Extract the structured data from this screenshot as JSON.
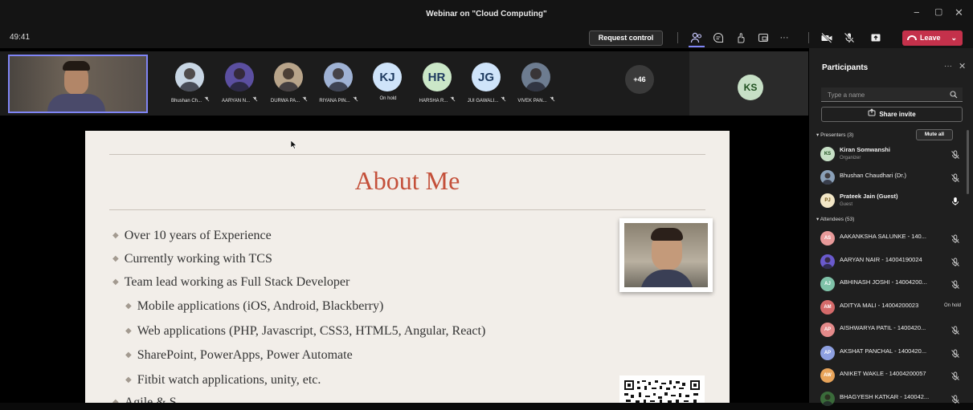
{
  "window": {
    "title": "Webinar on \"Cloud Computing\"",
    "minimize": "−",
    "maximize": "▢",
    "close": "✕"
  },
  "toolbar": {
    "timer": "49:41",
    "request_control": "Request control",
    "leave": "Leave",
    "leave_dropdown": "⌄",
    "more": "···"
  },
  "strip": {
    "participants": [
      {
        "name": "Bhushan Ch...",
        "initials": "",
        "bg": "#c8d6e4"
      },
      {
        "name": "AARYAN N...",
        "initials": "",
        "bg": "#5b4fa0"
      },
      {
        "name": "DURWA PA...",
        "initials": "",
        "bg": "#b8a48a"
      },
      {
        "name": "RIYANA PIN...",
        "initials": "",
        "bg": "#9fb2d4"
      },
      {
        "name": "On hold",
        "initials": "KJ",
        "bg": "#cfe4fa"
      },
      {
        "name": "HARSHA R...",
        "initials": "HR",
        "bg": "#cbe7c8"
      },
      {
        "name": "JUI GAWALI...",
        "initials": "JG",
        "bg": "#cfe4fa"
      },
      {
        "name": "VIVEK PAN...",
        "initials": "",
        "bg": "#6d7c90"
      }
    ],
    "overflow": "+46",
    "host_initials": "KS"
  },
  "slide": {
    "title": "About Me",
    "bullets": [
      "Over 10 years of Experience",
      "Currently working with TCS",
      "Team lead working as Full Stack Developer"
    ],
    "sub_bullets": [
      "Mobile applications (iOS, Android, Blackberry)",
      "Web applications (PHP, Javascript, CSS3, HTML5, Angular, React)",
      "SharePoint, PowerApps, Power Automate",
      "Fitbit watch applications, unity, etc."
    ],
    "partial_bullet": "Agile & S..."
  },
  "panel": {
    "title": "Participants",
    "more": "···",
    "close": "✕",
    "search_placeholder": "Type a name",
    "share_invite": "Share invite",
    "presenters_header": "Presenters (3)",
    "mute_all": "Mute all",
    "attendees_header": "Attendees (53)",
    "presenters": [
      {
        "name": "Kiran Somwanshi",
        "role": "Organizer",
        "initials": "KS",
        "bg": "#c7e0c6",
        "fg": "#1e4f1e"
      },
      {
        "name": "Bhushan Chaudhari (Dr.)",
        "role": "",
        "initials": "",
        "bg": "#8aa0b8",
        "fg": "#fff"
      },
      {
        "name": "Prateek Jain (Guest)",
        "role": "Guest",
        "initials": "PJ",
        "bg": "#f3e7c7",
        "fg": "#6b4f10"
      }
    ],
    "attendees": [
      {
        "name": "AAKANKSHA SALUNKE - 140...",
        "initials": "AS",
        "bg": "#e89a9a",
        "fg": "#fff",
        "status": ""
      },
      {
        "name": "AARYAN NAIR - 14004190024",
        "initials": "",
        "bg": "#6a5acd",
        "fg": "#fff",
        "status": ""
      },
      {
        "name": "ABHINASH JOSHI - 14004200...",
        "initials": "AJ",
        "bg": "#7fc2a8",
        "fg": "#fff",
        "status": ""
      },
      {
        "name": "ADITYA MALI - 14004200023",
        "initials": "AM",
        "bg": "#d46a6a",
        "fg": "#fff",
        "status": "On hold"
      },
      {
        "name": "AISHWARYA PATIL - 1400420...",
        "initials": "AP",
        "bg": "#e48a8a",
        "fg": "#fff",
        "status": ""
      },
      {
        "name": "AKSHAT PANCHAL - 1400420...",
        "initials": "AP",
        "bg": "#8ea0e0",
        "fg": "#fff",
        "status": ""
      },
      {
        "name": "ANIKET WAKLE - 14004200057",
        "initials": "AW",
        "bg": "#e8a45a",
        "fg": "#fff",
        "status": ""
      },
      {
        "name": "BHAGYESH KATKAR - 140042...",
        "initials": "",
        "bg": "#3a6b3a",
        "fg": "#fff",
        "status": ""
      }
    ]
  },
  "colors": {
    "accent": "#7f85f5",
    "leave": "#c4314b",
    "slide_title": "#c4503a"
  },
  "icons": [
    "people-icon",
    "chat-icon",
    "reactions-icon",
    "rooms-icon",
    "camera-off-icon",
    "mic-off-icon",
    "share-screen-icon",
    "phone-icon",
    "search-icon",
    "share-invite-icon",
    "mic-muted-icon",
    "mic-on-icon",
    "mouse-cursor-icon"
  ]
}
